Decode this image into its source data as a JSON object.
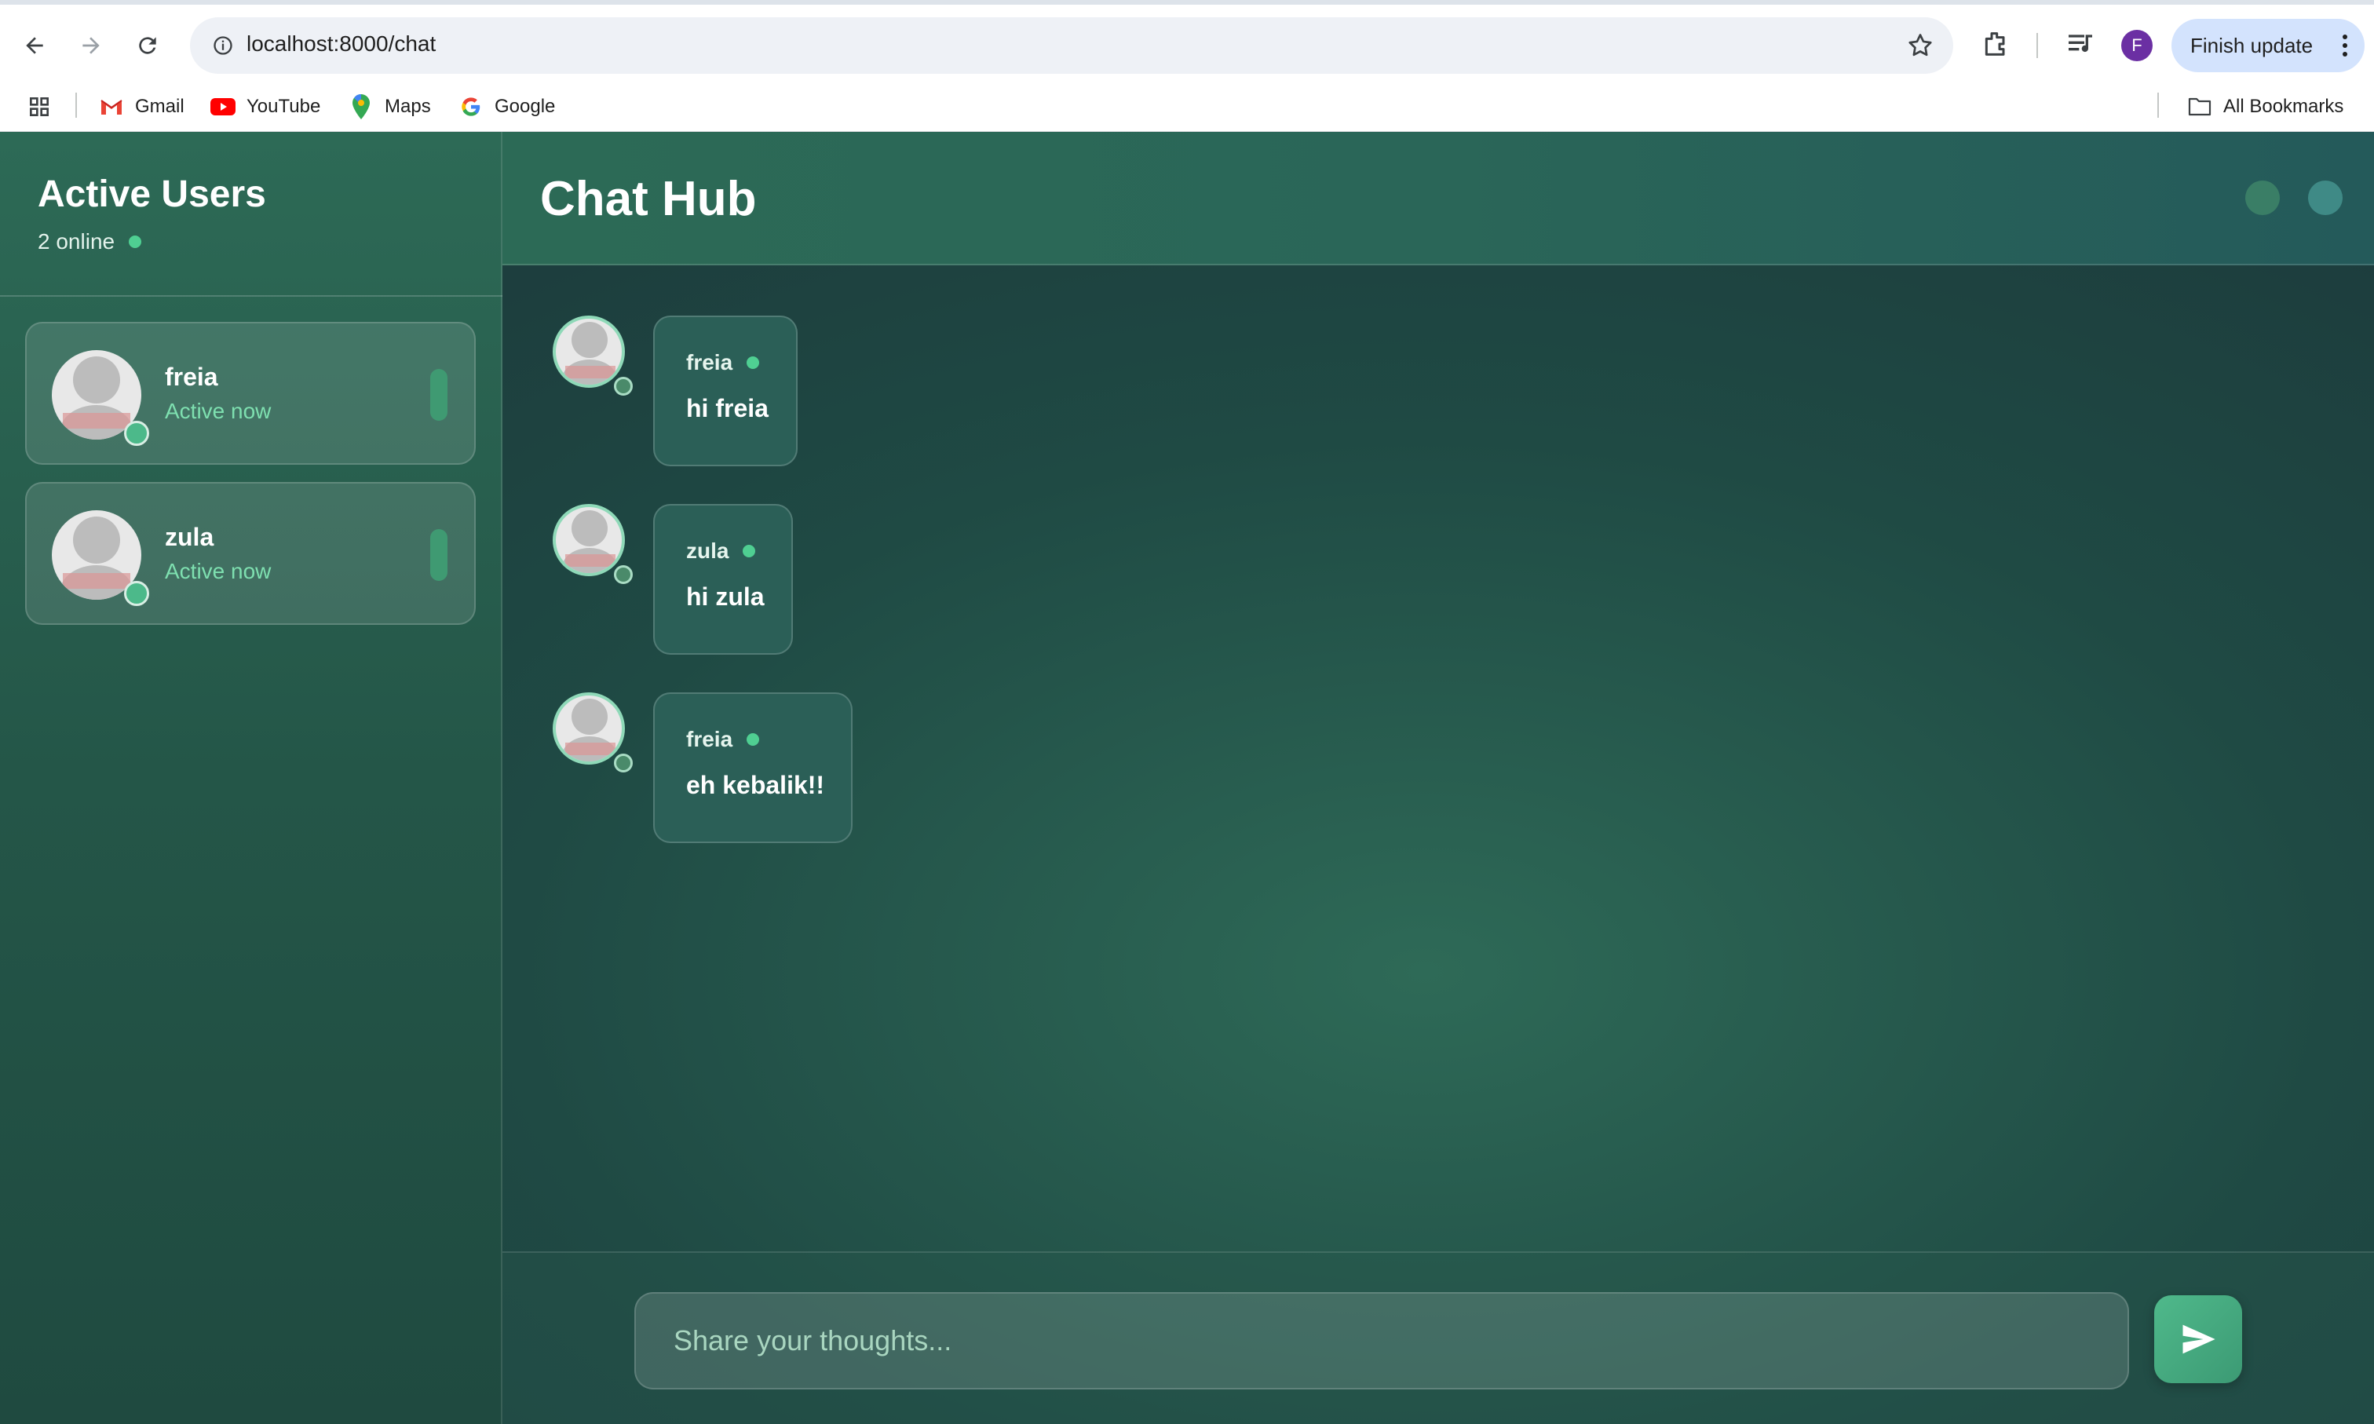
{
  "browser": {
    "url": "localhost:8000/chat",
    "profile_initial": "F",
    "finish_update": "Finish update",
    "bookmarks": [
      "Gmail",
      "YouTube",
      "Maps",
      "Google"
    ],
    "all_bookmarks": "All Bookmarks"
  },
  "sidebar": {
    "title": "Active Users",
    "online_count": "2 online",
    "users": [
      {
        "name": "freia",
        "status": "Active now"
      },
      {
        "name": "zula",
        "status": "Active now"
      }
    ]
  },
  "chat": {
    "title": "Chat Hub",
    "messages": [
      {
        "author": "freia",
        "text": "hi freia"
      },
      {
        "author": "zula",
        "text": "hi zula"
      },
      {
        "author": "freia",
        "text": "eh kebalik!!"
      }
    ],
    "input_placeholder": "Share your thoughts..."
  },
  "colors": {
    "accent_green": "#4fcf92",
    "status_text": "#7ee0b0",
    "send_button": "#4fb98b"
  },
  "icons": [
    "back-arrow-icon",
    "forward-arrow-icon",
    "reload-icon",
    "site-info-icon",
    "bookmark-star-icon",
    "extensions-icon",
    "media-icon",
    "apps-grid-icon",
    "folder-icon",
    "send-icon"
  ]
}
